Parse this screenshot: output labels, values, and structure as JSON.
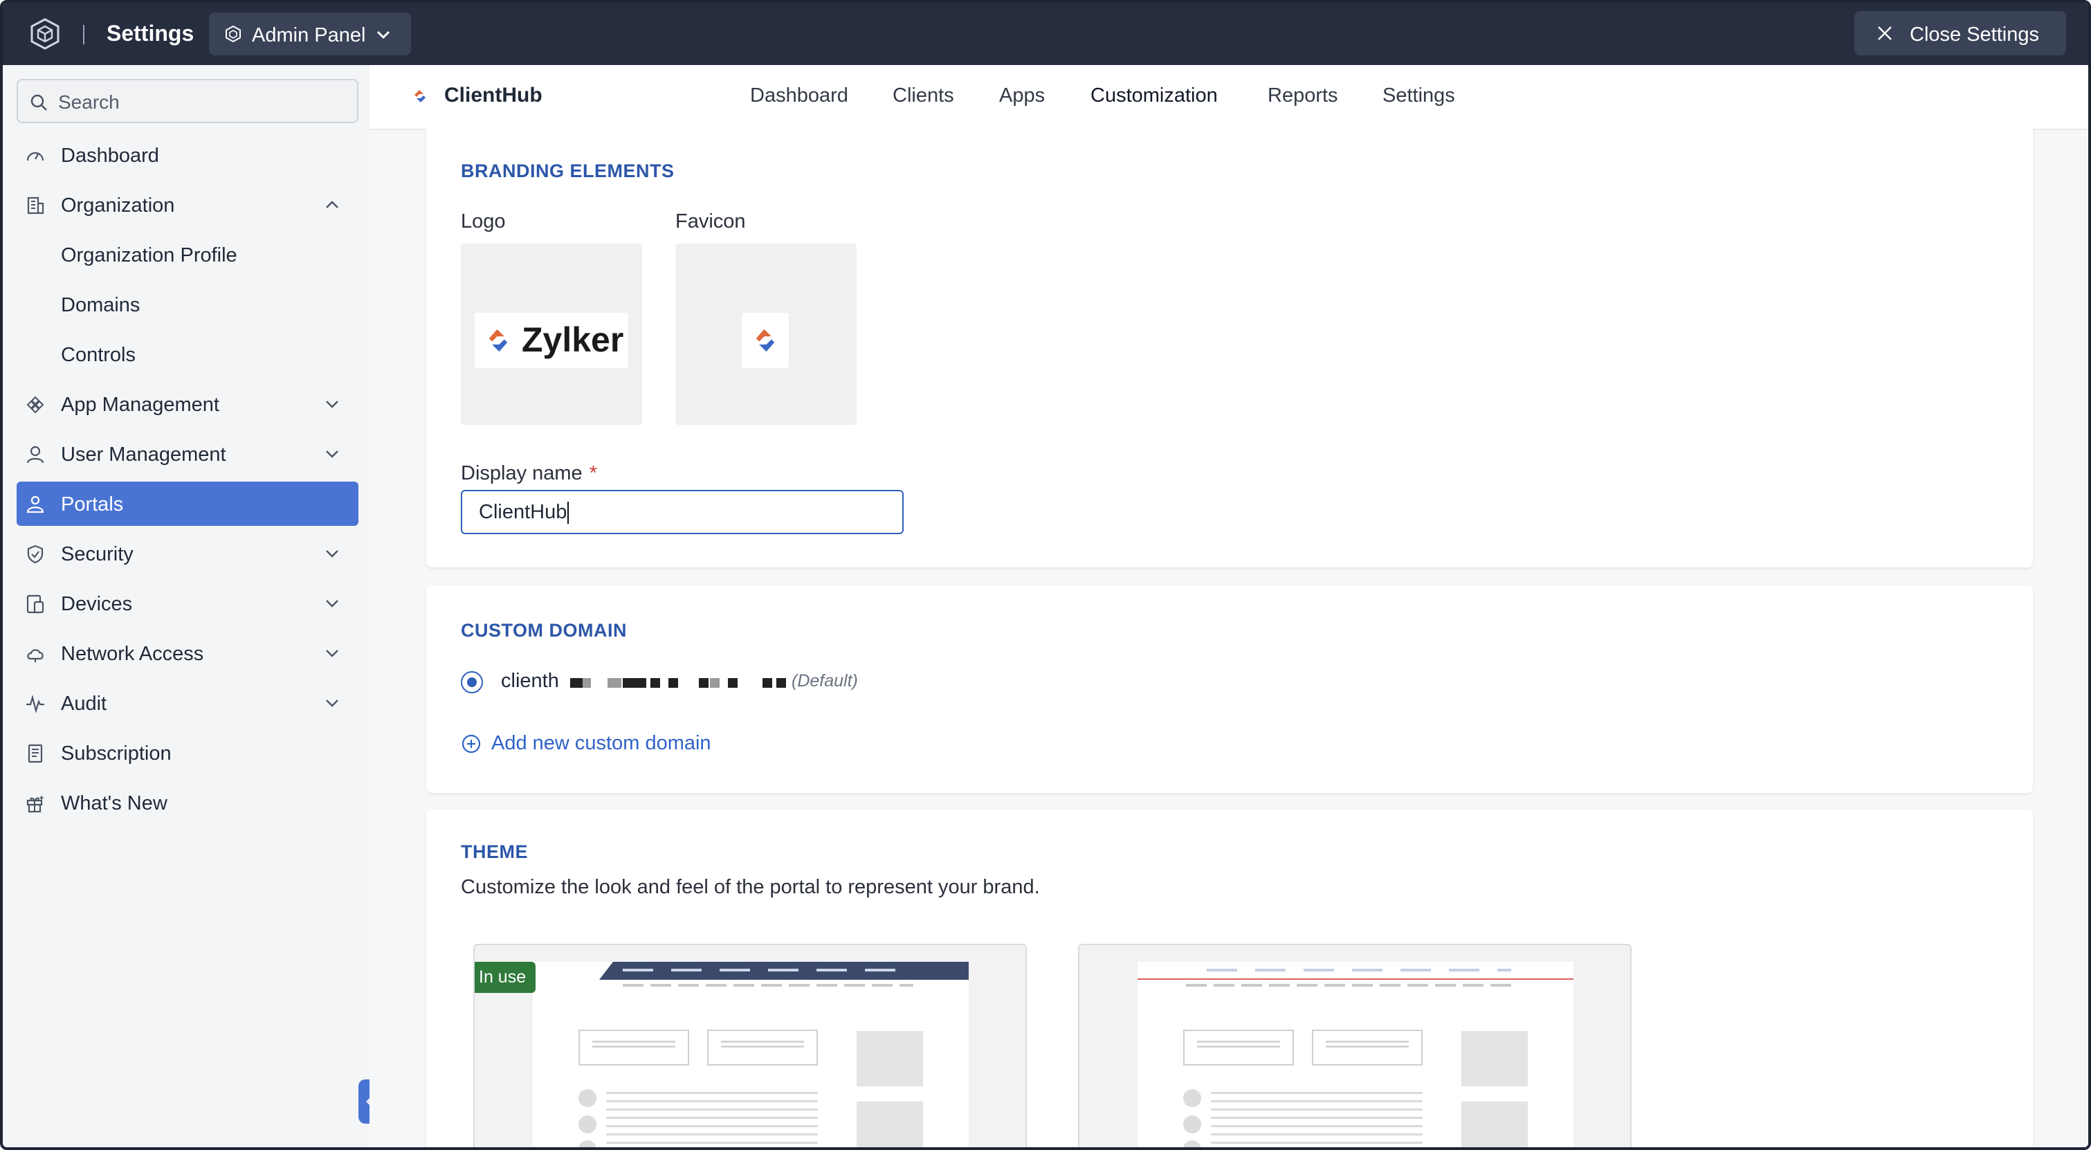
{
  "topbar": {
    "title": "Settings",
    "admin_panel_label": "Admin Panel",
    "close_label": "Close Settings",
    "bg_color": "#262d3f"
  },
  "sidebar": {
    "search_placeholder": "Search",
    "items": [
      {
        "label": "Dashboard",
        "icon": "gauge-icon"
      },
      {
        "label": "Organization",
        "icon": "building-icon",
        "expanded": true
      },
      {
        "label": "Organization Profile",
        "sub": true
      },
      {
        "label": "Domains",
        "sub": true
      },
      {
        "label": "Controls",
        "sub": true
      },
      {
        "label": "App Management",
        "icon": "apps-icon"
      },
      {
        "label": "User Management",
        "icon": "user-icon"
      },
      {
        "label": "Portals",
        "icon": "portal-icon",
        "active": true
      },
      {
        "label": "Security",
        "icon": "shield-icon"
      },
      {
        "label": "Devices",
        "icon": "devices-icon"
      },
      {
        "label": "Network Access",
        "icon": "cloud-icon"
      },
      {
        "label": "Audit",
        "icon": "pulse-icon"
      },
      {
        "label": "Subscription",
        "icon": "receipt-icon"
      },
      {
        "label": "What's New",
        "icon": "gift-icon"
      }
    ],
    "active_color": "#4a74d3"
  },
  "header": {
    "app_name": "ClientHub",
    "tabs": [
      {
        "label": "Dashboard"
      },
      {
        "label": "Clients"
      },
      {
        "label": "Apps"
      },
      {
        "label": "Customization",
        "active": true
      },
      {
        "label": "Reports"
      },
      {
        "label": "Settings"
      }
    ]
  },
  "branding": {
    "section_title": "BRANDING ELEMENTS",
    "logo_label": "Logo",
    "favicon_label": "Favicon",
    "logo_text": "Zylker",
    "display_name_label": "Display name",
    "required_mark": "*",
    "display_name_value": "ClientHub"
  },
  "custom_domain": {
    "section_title": "CUSTOM DOMAIN",
    "domain_prefix": "clienth",
    "default_tag": "(Default)",
    "add_link": "Add new custom domain"
  },
  "theme": {
    "section_title": "THEME",
    "description": "Customize the look and feel of the portal to represent your brand.",
    "in_use_badge": "In use"
  }
}
